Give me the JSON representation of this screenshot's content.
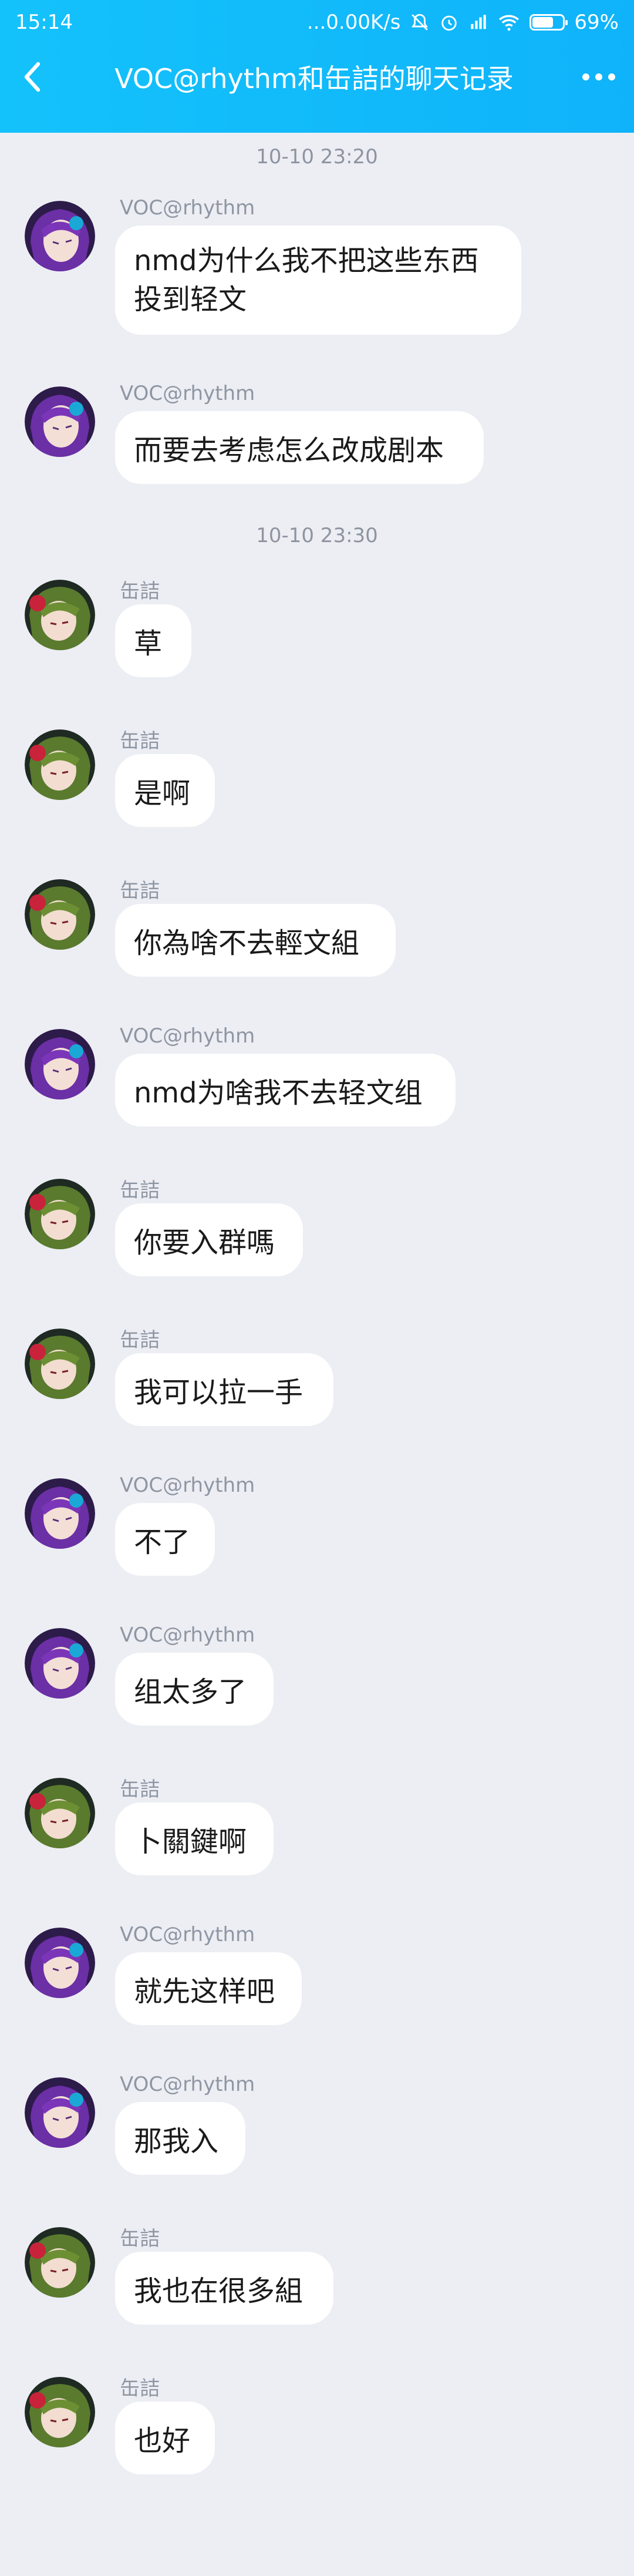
{
  "status": {
    "time": "15:14",
    "network": "...0.00K/s",
    "battery": "69%",
    "battery_level": 0.69
  },
  "header": {
    "title": "VOC@rhythm和缶詰的聊天记录"
  },
  "timestamps": [
    "10-10 23:20",
    "10-10 23:30"
  ],
  "messages": [
    {
      "sender": "VOC@rhythm",
      "text": "nmd为什么我不把这些东西\n投到轻文"
    },
    {
      "sender": "VOC@rhythm",
      "text": "而要去考虑怎么改成剧本"
    },
    {
      "sender": "缶詰",
      "text": "草"
    },
    {
      "sender": "缶詰",
      "text": "是啊"
    },
    {
      "sender": "缶詰",
      "text": "你為啥不去輕文組"
    },
    {
      "sender": "VOC@rhythm",
      "text": "nmd为啥我不去轻文组"
    },
    {
      "sender": "缶詰",
      "text": "你要入群嗎"
    },
    {
      "sender": "缶詰",
      "text": "我可以拉一手"
    },
    {
      "sender": "VOC@rhythm",
      "text": "不了"
    },
    {
      "sender": "VOC@rhythm",
      "text": "组太多了"
    },
    {
      "sender": "缶詰",
      "text": "卜關鍵啊"
    },
    {
      "sender": "VOC@rhythm",
      "text": "就先这样吧"
    },
    {
      "sender": "VOC@rhythm",
      "text": "那我入"
    },
    {
      "sender": "缶詰",
      "text": "我也在很多組"
    },
    {
      "sender": "缶詰",
      "text": "也好"
    }
  ]
}
